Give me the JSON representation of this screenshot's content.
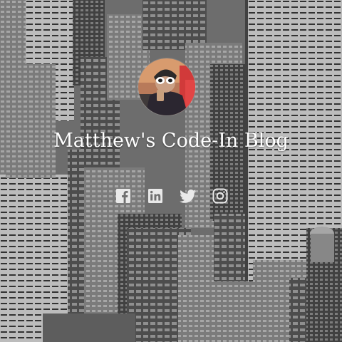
{
  "blog": {
    "title": "Matthew's Code-In Blog"
  },
  "social_links": [
    {
      "icon": "facebook-icon"
    },
    {
      "icon": "linkedin-icon"
    },
    {
      "icon": "twitter-icon"
    },
    {
      "icon": "instagram-icon"
    }
  ],
  "colors": {
    "title": "#ffffff",
    "icons": "#e9e9e9",
    "overlay": "#6f6f6f"
  }
}
